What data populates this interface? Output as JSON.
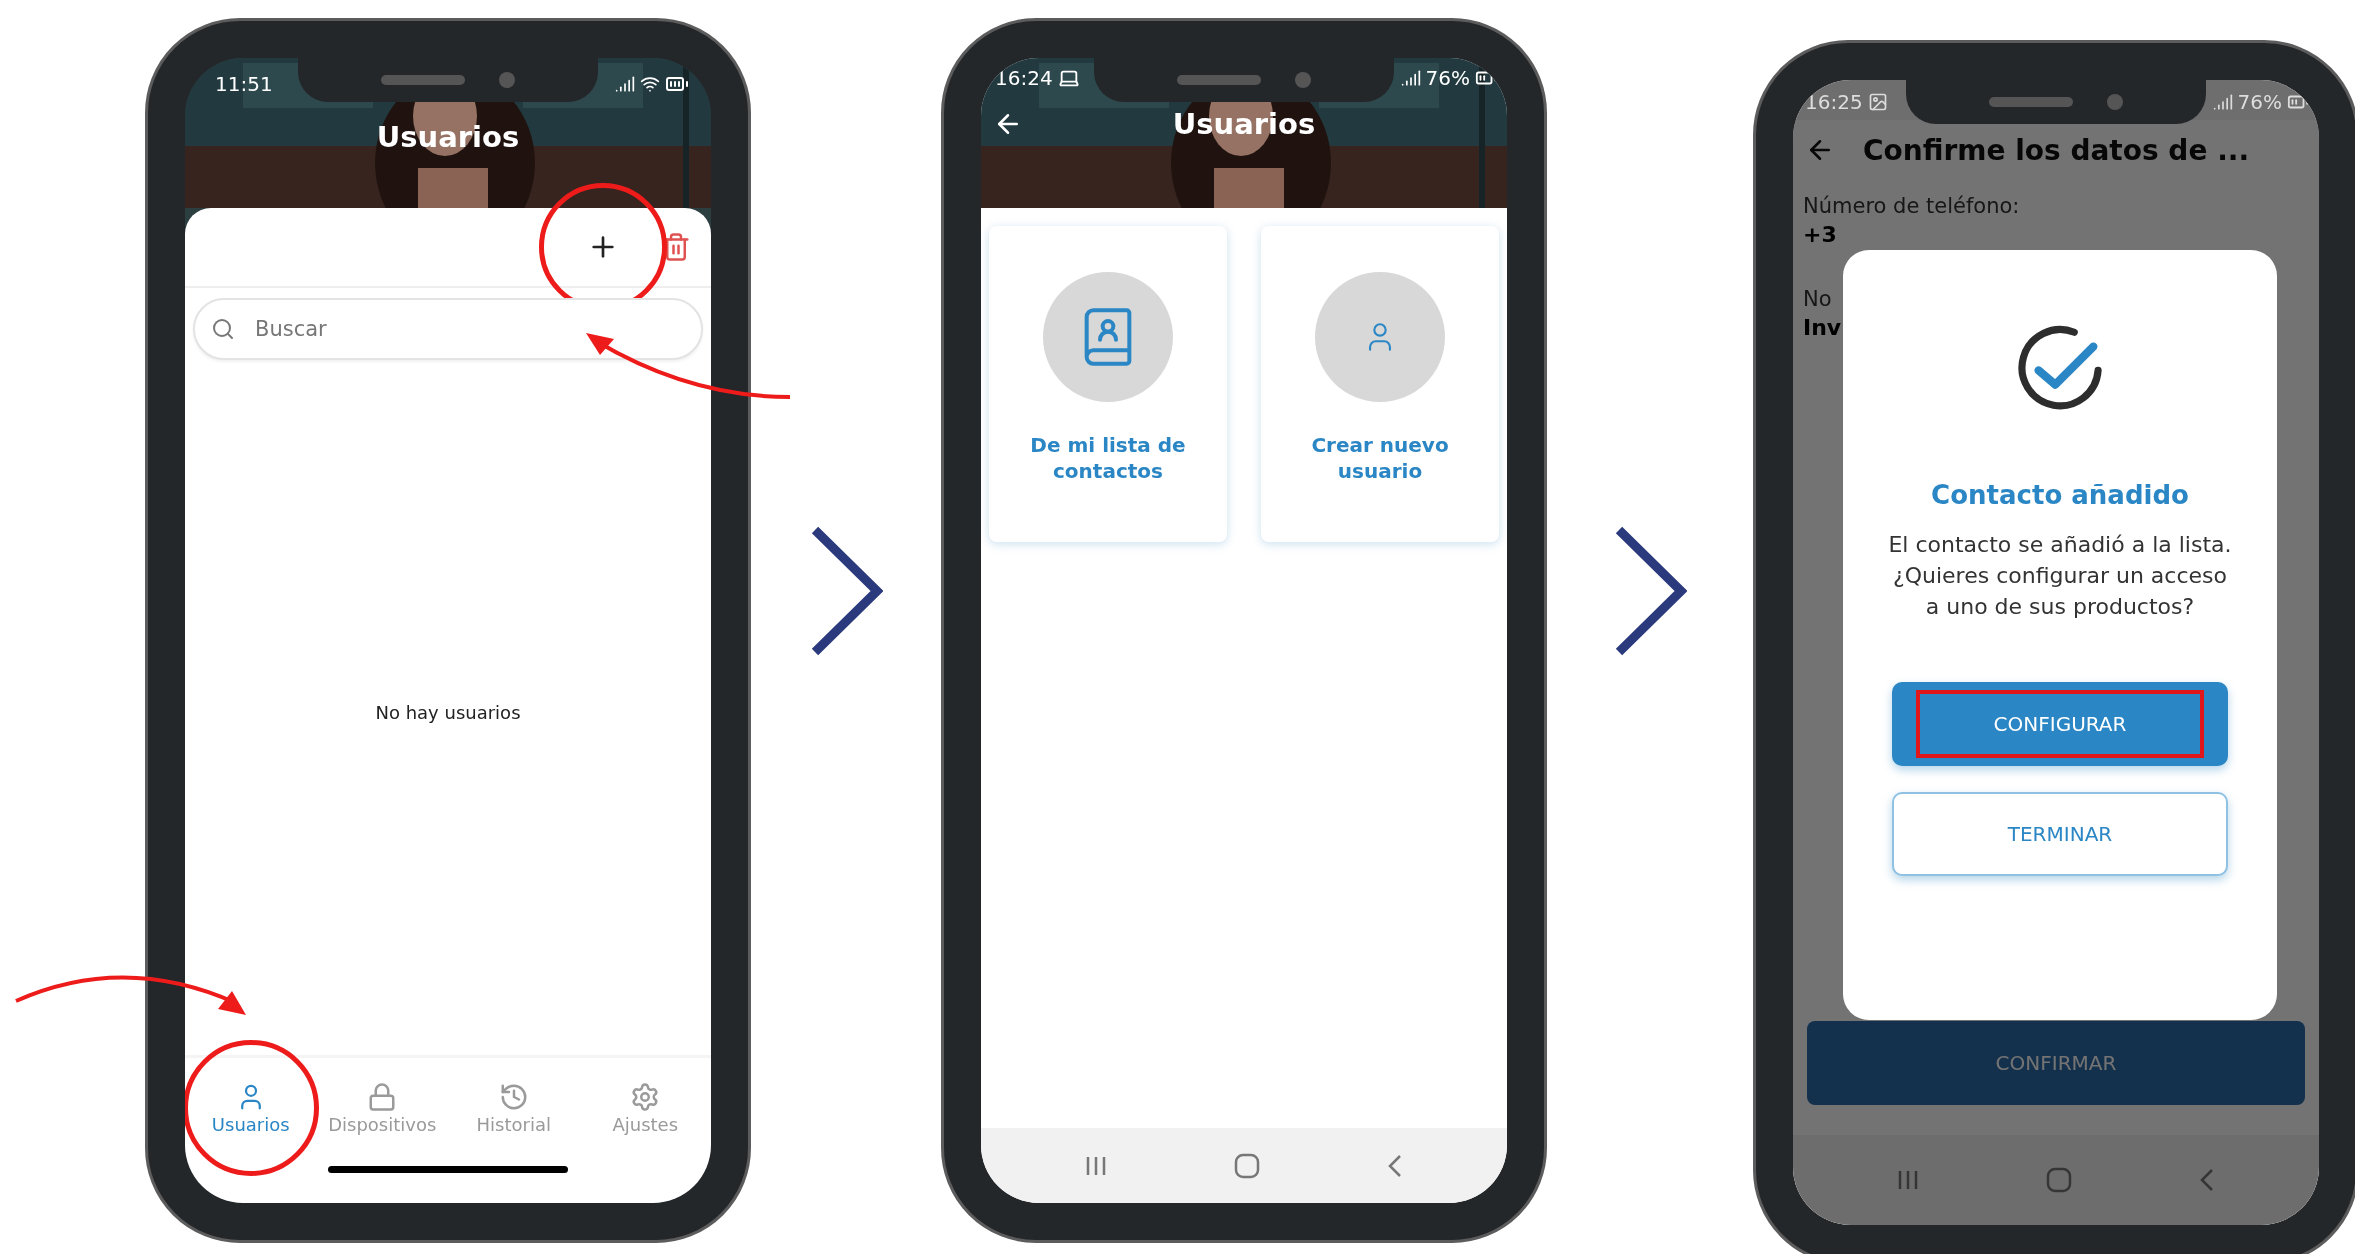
{
  "phones": [
    {
      "kind": "user_list",
      "status_bar": {
        "time": "11:51"
      },
      "title": "Usuarios",
      "add_button": {
        "highlighted": true
      },
      "search": {
        "placeholder": "Buscar"
      },
      "empty_message": "No hay usuarios",
      "tabs": [
        {
          "label": "Usuarios",
          "selected": true,
          "highlighted": true
        },
        {
          "label": "Dispositivos",
          "selected": false,
          "highlighted": false
        },
        {
          "label": "Historial",
          "selected": false,
          "highlighted": false
        },
        {
          "label": "Ajustes",
          "selected": false,
          "highlighted": false
        }
      ]
    },
    {
      "kind": "add_options",
      "status_bar": {
        "time": "16:24",
        "battery": "76%"
      },
      "title": "Usuarios",
      "options": [
        {
          "label": "De mi lista de contactos"
        },
        {
          "label": "Crear nuevo usuario"
        }
      ]
    },
    {
      "kind": "confirm",
      "status_bar": {
        "time": "16:25",
        "battery": "76%"
      },
      "title": "Confirme los datos de ...",
      "fields": [
        {
          "label": "Número de teléfono:",
          "value": "+3"
        },
        {
          "label": "No",
          "value": "Inv"
        }
      ],
      "confirm_button": "CONFIRMAR",
      "dialog": {
        "title": "Contacto añadido",
        "message": "El contacto se añadió a la lista. ¿Quieres configurar un acceso a uno de sus productos?",
        "buttons": [
          {
            "label": "CONFIGURAR",
            "kind": "primary",
            "highlighted": true
          },
          {
            "label": "TERMINAR",
            "kind": "secondary",
            "highlighted": false
          }
        ]
      }
    }
  ]
}
